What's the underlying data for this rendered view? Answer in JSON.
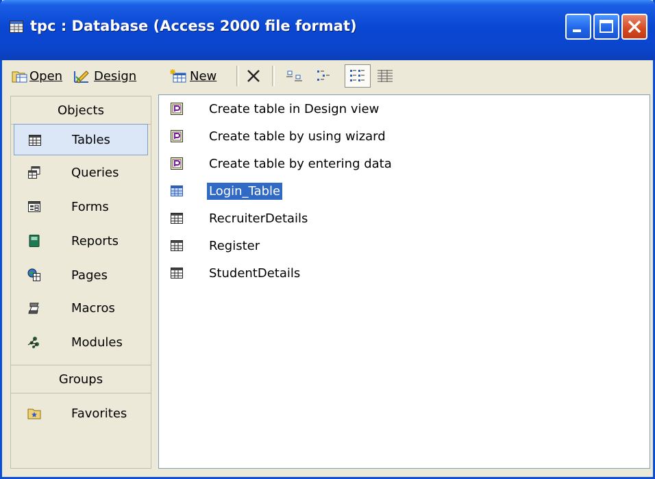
{
  "window": {
    "title": "tpc : Database (Access 2000 file format)",
    "accent": "#0a47d2"
  },
  "toolbar": {
    "open_label": "Open",
    "design_label": "Design",
    "new_label": "New"
  },
  "sidebar": {
    "objects_header": "Objects",
    "items": [
      {
        "label": "Tables",
        "icon": "table-icon"
      },
      {
        "label": "Queries",
        "icon": "query-icon"
      },
      {
        "label": "Forms",
        "icon": "form-icon"
      },
      {
        "label": "Reports",
        "icon": "report-icon"
      },
      {
        "label": "Pages",
        "icon": "page-icon"
      },
      {
        "label": "Macros",
        "icon": "macro-icon"
      },
      {
        "label": "Modules",
        "icon": "module-icon"
      }
    ],
    "groups_header": "Groups",
    "groups": [
      {
        "label": "Favorites",
        "icon": "favorites-folder-icon"
      }
    ]
  },
  "list": {
    "items": [
      {
        "label": "Create table in Design view",
        "icon": "shortcut-icon"
      },
      {
        "label": "Create table by using wizard",
        "icon": "shortcut-icon"
      },
      {
        "label": "Create table by entering data",
        "icon": "shortcut-icon"
      },
      {
        "label": "Login_Table",
        "icon": "table-icon"
      },
      {
        "label": "RecruiterDetails",
        "icon": "table-icon"
      },
      {
        "label": "Register",
        "icon": "table-icon"
      },
      {
        "label": "StudentDetails",
        "icon": "table-icon"
      }
    ]
  }
}
